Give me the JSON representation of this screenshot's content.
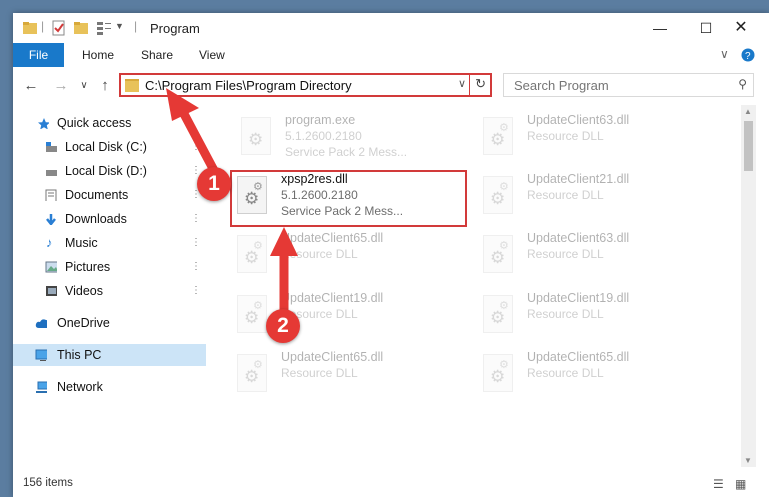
{
  "window": {
    "title": "Program",
    "min_icon": "minimize-icon",
    "max_icon": "maximize-icon",
    "close_icon": "close-icon"
  },
  "ribbon": {
    "tabs": [
      "File",
      "Home",
      "Share",
      "View"
    ]
  },
  "nav": {
    "address": "C:\\Program Files\\Program Directory",
    "search_placeholder": "Search Program"
  },
  "sidebar": {
    "items": [
      {
        "label": "Quick access"
      },
      {
        "label": "Local Disk (C:)"
      },
      {
        "label": "Local Disk (D:)"
      },
      {
        "label": "Documents"
      },
      {
        "label": "Downloads"
      },
      {
        "label": "Music"
      },
      {
        "label": "Pictures"
      },
      {
        "label": "Videos"
      },
      {
        "label": "OneDrive"
      },
      {
        "label": "This PC"
      },
      {
        "label": "Network"
      }
    ]
  },
  "files": [
    {
      "name": "program.exe",
      "l2": "5.1.2600.2180",
      "l3": "Service Pack 2 Mess..."
    },
    {
      "name": "UpdateClient63.dll",
      "l2": "Resource DLL"
    },
    {
      "name": "xpsp2res.dll",
      "l2": "5.1.2600.2180",
      "l3": "Service Pack 2 Mess..."
    },
    {
      "name": "UpdateClient21.dll",
      "l2": "Resource DLL"
    },
    {
      "name": "UpdateClient65.dll",
      "l2": "Resource DLL"
    },
    {
      "name": "UpdateClient63.dll",
      "l2": "Resource DLL"
    },
    {
      "name": "UpdateClient19.dll",
      "l2": "Resource DLL"
    },
    {
      "name": "UpdateClient19.dll",
      "l2": "Resource DLL"
    },
    {
      "name": "UpdateClient65.dll",
      "l2": "Resource DLL"
    },
    {
      "name": "UpdateClient65.dll",
      "l2": "Resource DLL"
    }
  ],
  "annotations": {
    "badge1": "1",
    "badge2": "2",
    "color": "#e53935"
  },
  "status": {
    "count": "156 items"
  }
}
